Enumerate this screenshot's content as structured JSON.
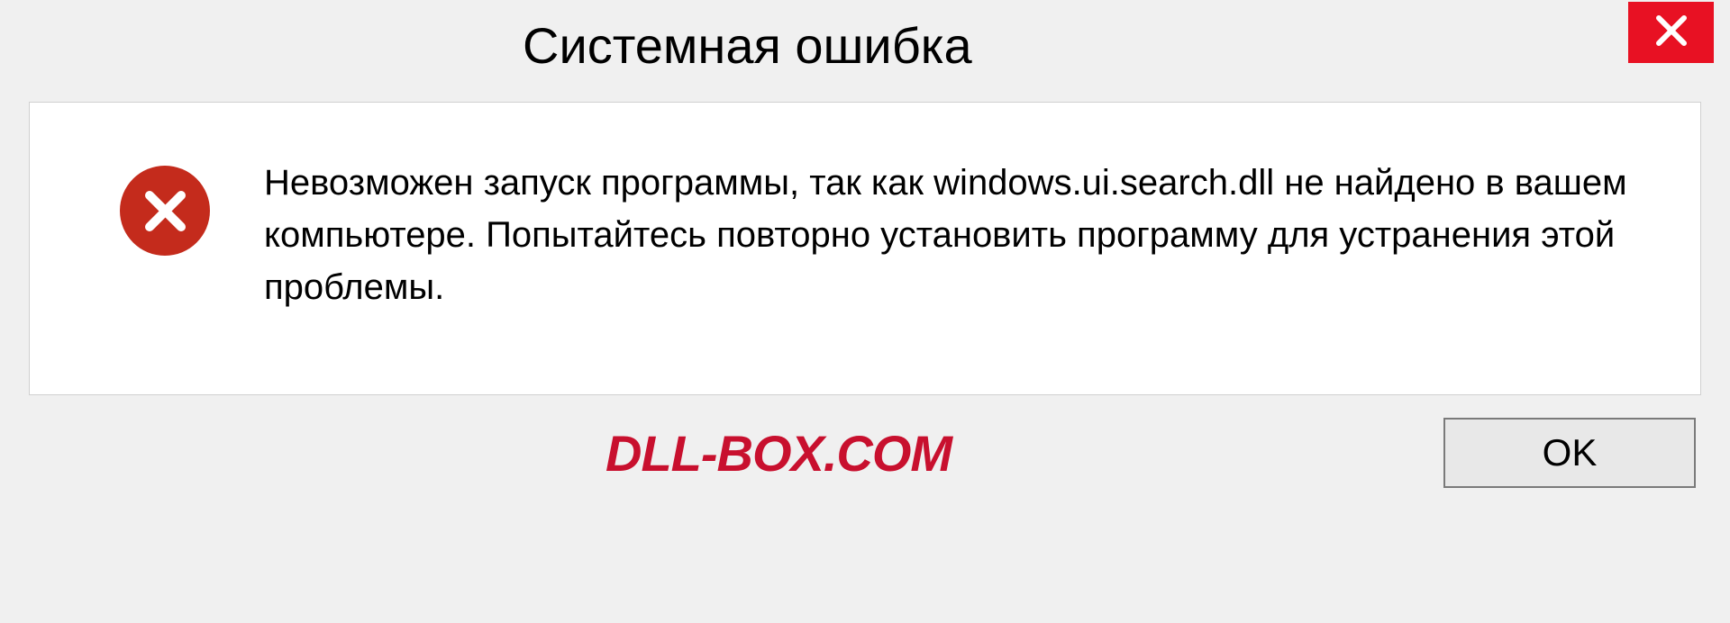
{
  "dialog": {
    "title": "Системная ошибка",
    "message": "Невозможен запуск программы, так как windows.ui.search.dll  не найдено в вашем компьютере. Попытайтесь повторно установить программу для устранения этой проблемы.",
    "ok_label": "OK"
  },
  "watermark": {
    "text": "DLL-BOX.COM"
  },
  "colors": {
    "close_button_bg": "#e81123",
    "error_icon_bg": "#c42b1c",
    "watermark_color": "#c8102e"
  }
}
